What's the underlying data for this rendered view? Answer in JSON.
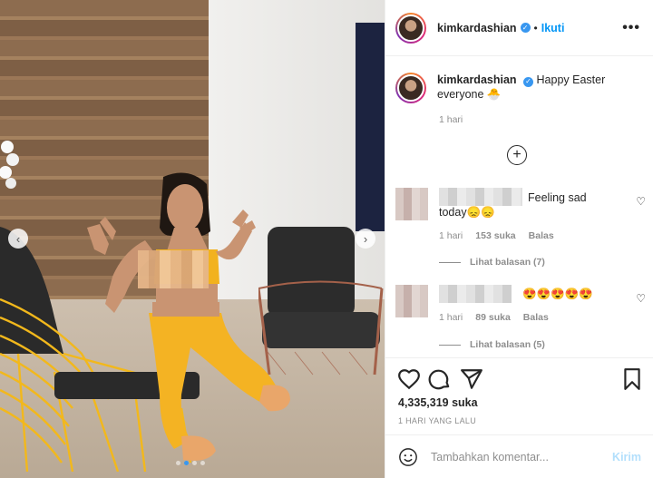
{
  "post": {
    "username": "kimkardashian",
    "follow_label": "Ikuti",
    "separator": "•",
    "more_icon": "more-horizontal-icon"
  },
  "caption": {
    "username": "kimkardashian",
    "text": "Happy Easter everyone 🐣",
    "time": "1 hari"
  },
  "comments": [
    {
      "text": "Feeling sad today😞😞",
      "time": "1 hari",
      "likes": "153 suka",
      "reply": "Balas",
      "view_replies": "Lihat balasan (7)"
    },
    {
      "text": "😍😍😍😍😍",
      "time": "1 hari",
      "likes": "89 suka",
      "reply": "Balas",
      "view_replies": "Lihat balasan (5)"
    }
  ],
  "stats": {
    "likes": "4,335,319 suka",
    "date": "1 HARI YANG LALU"
  },
  "composer": {
    "placeholder": "Tambahkan komentar...",
    "send_label": "Kirim"
  },
  "carousel": {
    "total": 4,
    "active_index": 1
  },
  "colors": {
    "accent": "#0095f6",
    "send_disabled": "#b2dffc",
    "muted": "#8e8e8e"
  }
}
